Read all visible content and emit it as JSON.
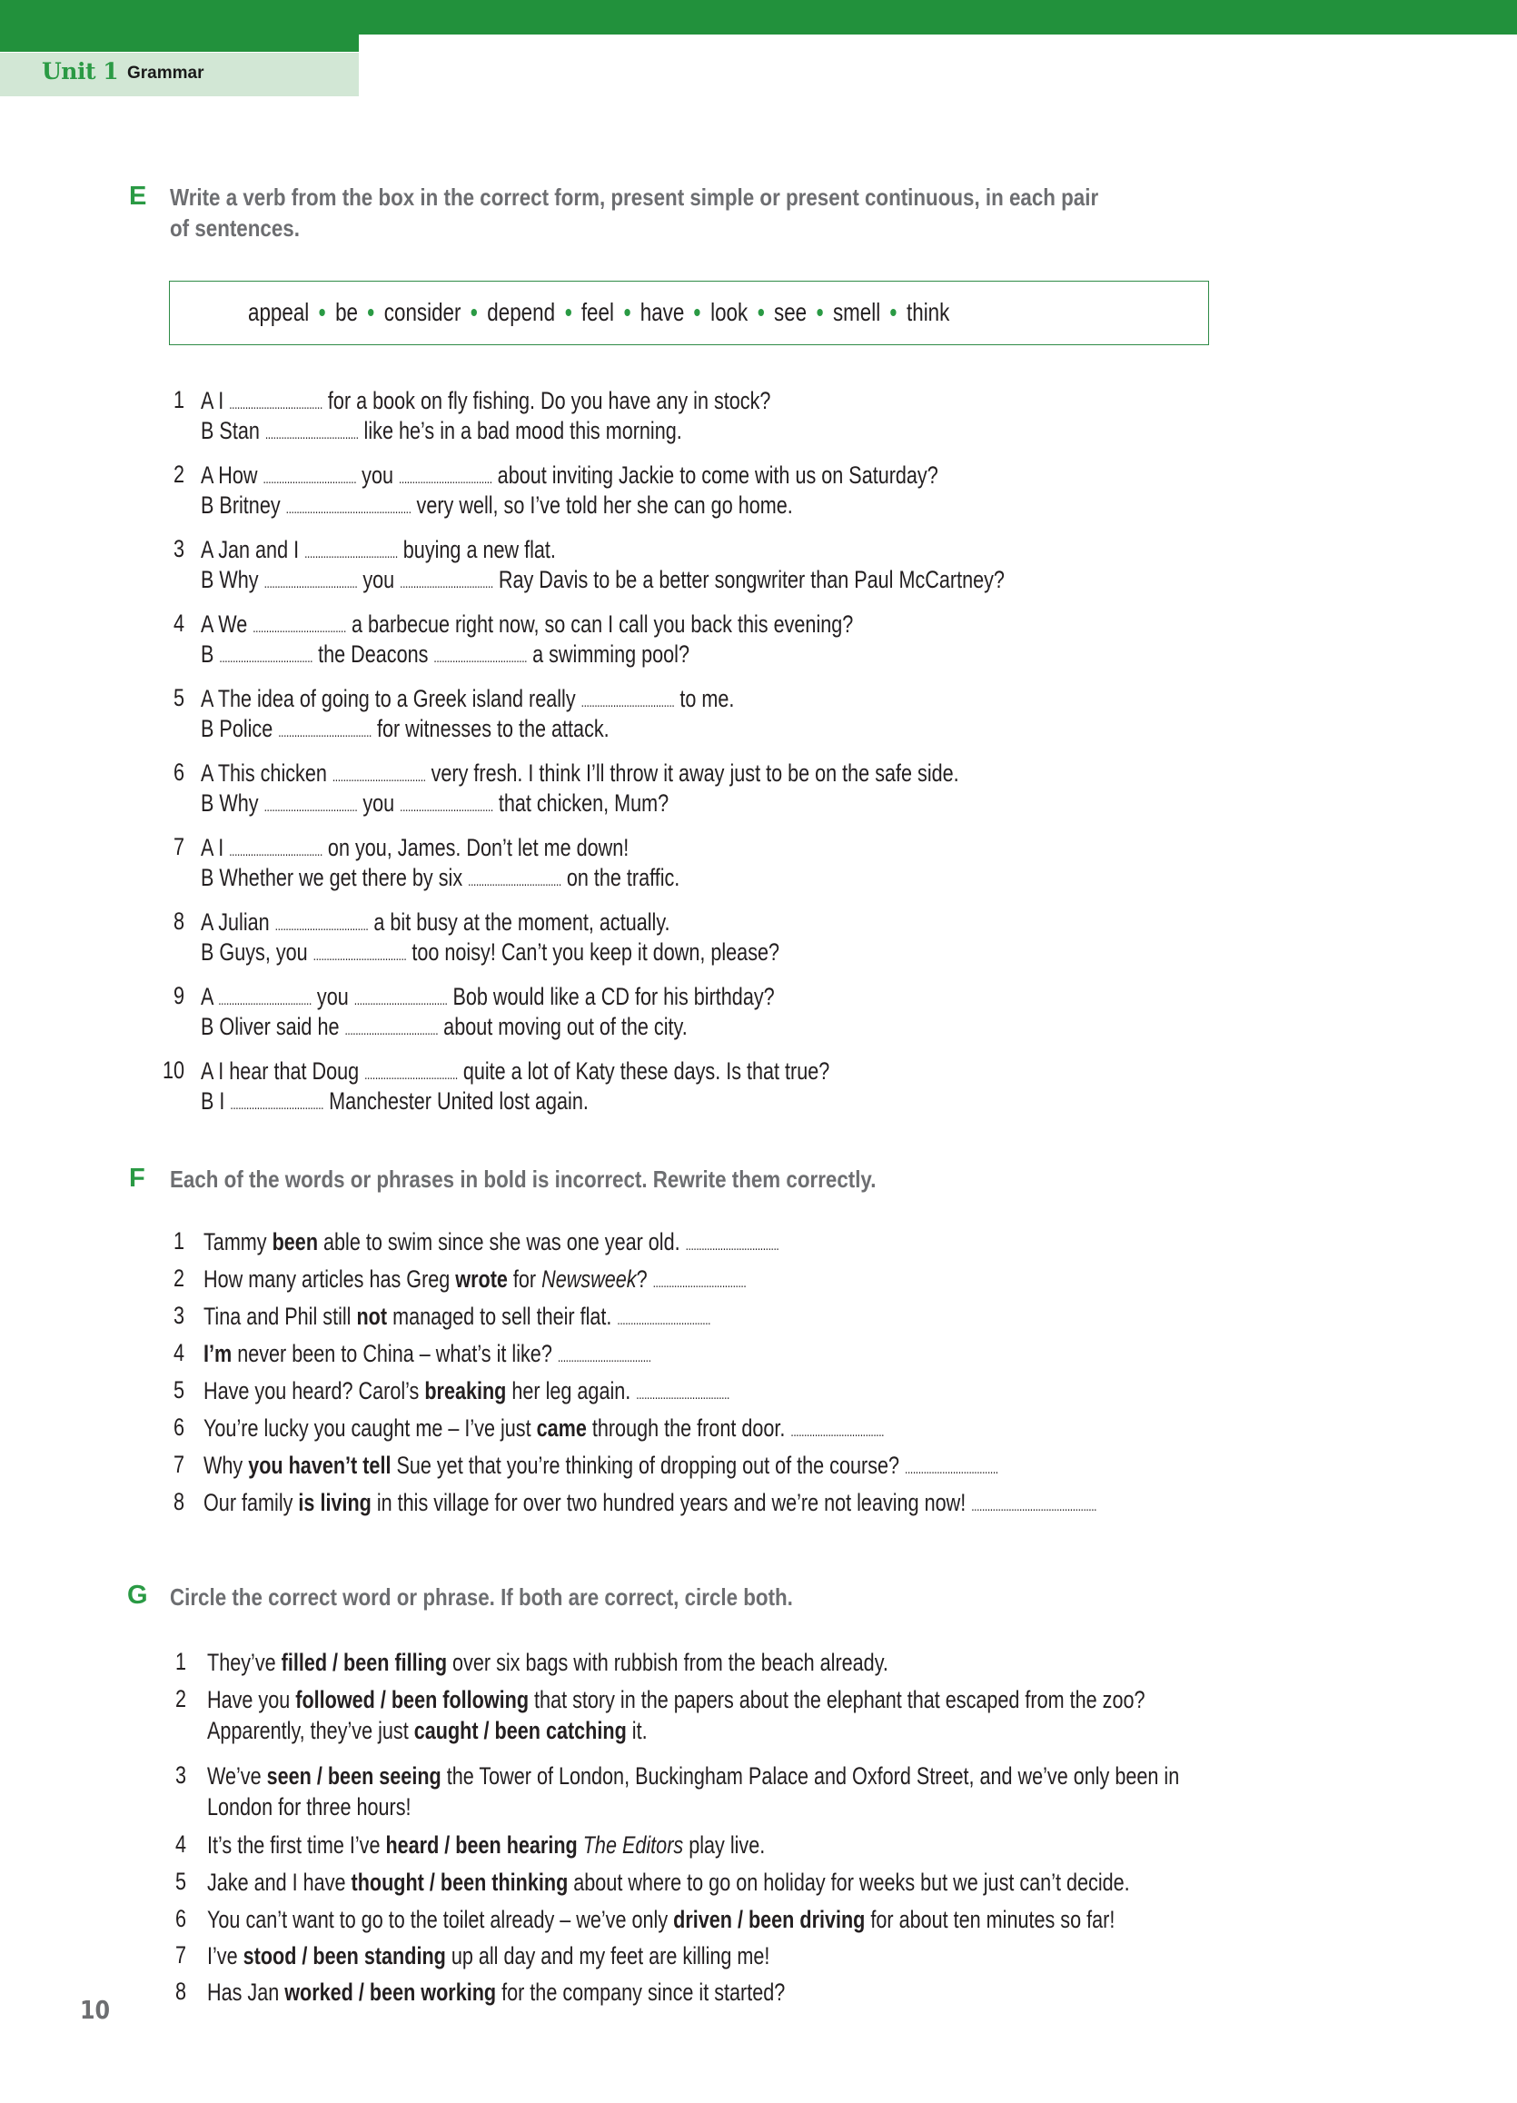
{
  "header": {
    "unit": "Unit 1",
    "section": "Grammar"
  },
  "colors": {
    "brand_green": "#22913c",
    "tab_light_green": "#d2e7d5",
    "instruction_gray": "#6d6e71"
  },
  "exercise_e": {
    "letter": "E",
    "instruction_line1": "Write a verb from the box in the correct form, present simple or present continuous, in each pair",
    "instruction_line2": "of sentences.",
    "word_box": [
      "appeal",
      "be",
      "consider",
      "depend",
      "feel",
      "have",
      "look",
      "see",
      "smell",
      "think"
    ],
    "blank": "...................................",
    "items": [
      {
        "num": "1",
        "a": [
          [
            "A I ",
            "blank"
          ],
          [
            " for a book on fly fishing. Do you have any in stock?"
          ]
        ],
        "b": [
          [
            "B Stan ",
            "blank"
          ],
          [
            " like he’s in a bad mood this morning."
          ]
        ]
      },
      {
        "num": "2",
        "a": [
          [
            "A How ",
            "blank"
          ],
          [
            " you ",
            "blank"
          ],
          [
            " about inviting Jackie to come with us on Saturday?"
          ]
        ],
        "b": [
          [
            "B Britney ",
            "blank_long"
          ],
          [
            " very well, so I’ve told her she can go home."
          ]
        ]
      },
      {
        "num": "3",
        "a": [
          [
            "A Jan and I ",
            "blank"
          ],
          [
            " buying a new flat."
          ]
        ],
        "b": [
          [
            "B Why ",
            "blank"
          ],
          [
            " you ",
            "blank"
          ],
          [
            " Ray Davis to be a better songwriter than Paul McCartney?"
          ]
        ]
      },
      {
        "num": "4",
        "a": [
          [
            "A We ",
            "blank"
          ],
          [
            " a barbecue right now, so can I call you back this evening?"
          ]
        ],
        "b": [
          [
            "B ",
            "blank"
          ],
          [
            " the Deacons ",
            "blank"
          ],
          [
            " a swimming pool?"
          ]
        ]
      },
      {
        "num": "5",
        "a": [
          [
            "A The idea of going to a Greek island really ",
            "blank"
          ],
          [
            " to me."
          ]
        ],
        "b": [
          [
            "B Police ",
            "blank"
          ],
          [
            " for witnesses to the attack."
          ]
        ]
      },
      {
        "num": "6",
        "a": [
          [
            "A This chicken ",
            "blank"
          ],
          [
            " very fresh. I think I’ll throw it away just to be on the safe side."
          ]
        ],
        "b": [
          [
            "B Why ",
            "blank"
          ],
          [
            " you ",
            "blank"
          ],
          [
            " that chicken, Mum?"
          ]
        ]
      },
      {
        "num": "7",
        "a": [
          [
            "A I ",
            "blank"
          ],
          [
            " on you, James. Don’t let me down!"
          ]
        ],
        "b": [
          [
            "B Whether we get there by six ",
            "blank"
          ],
          [
            " on the traffic."
          ]
        ]
      },
      {
        "num": "8",
        "a": [
          [
            "A Julian ",
            "blank"
          ],
          [
            " a bit busy at the moment, actually."
          ]
        ],
        "b": [
          [
            "B Guys, you ",
            "blank"
          ],
          [
            " too noisy! Can’t you keep it down, please?"
          ]
        ]
      },
      {
        "num": "9",
        "a": [
          [
            "A ",
            "blank"
          ],
          [
            " you ",
            "blank"
          ],
          [
            " Bob would like a CD for his birthday?"
          ]
        ],
        "b": [
          [
            "B Oliver said he ",
            "blank"
          ],
          [
            " about moving out of the city."
          ]
        ]
      },
      {
        "num": "10",
        "a": [
          [
            "A I hear that Doug ",
            "blank"
          ],
          [
            " quite a lot of Katy these days. Is that true?"
          ]
        ],
        "b": [
          [
            "B I ",
            "blank"
          ],
          [
            " Manchester United lost again."
          ]
        ]
      }
    ]
  },
  "exercise_f": {
    "letter": "F",
    "instruction": "Each of the words or phrases in bold is incorrect. Rewrite them correctly.",
    "items": [
      {
        "num": "1",
        "before": "Tammy ",
        "bold": "been",
        "after": " able to swim since she was one year old. ",
        "blank": "..................................."
      },
      {
        "num": "2",
        "before": "How many articles has Greg ",
        "bold": "wrote",
        "after": " for ",
        "italic": "Newsweek",
        "after2": "? ",
        "blank": "..................................."
      },
      {
        "num": "3",
        "before": "Tina and Phil still ",
        "bold": "not",
        "after": " managed to sell their flat.  ",
        "blank": "..................................."
      },
      {
        "num": "4",
        "before": "",
        "bold": "I’m",
        "after": " never been to China – what’s it like? ",
        "blank": "..................................."
      },
      {
        "num": "5",
        "before": "Have you heard? Carol’s ",
        "bold": "breaking",
        "after": " her leg again. ",
        "blank": "..................................."
      },
      {
        "num": "6",
        "before": "You’re lucky you caught me – I’ve just ",
        "bold": "came",
        "after": " through the front door. ",
        "blank": "..................................."
      },
      {
        "num": "7",
        "before": "Why ",
        "bold": "you haven’t tell",
        "after": " Sue yet that you’re thinking of dropping out of the course? ",
        "blank": "..................................."
      },
      {
        "num": "8",
        "before": "Our family ",
        "bold": "is living",
        "after": " in this village for over two hundred years and we’re not leaving now! ",
        "blank": "..............................................."
      }
    ]
  },
  "exercise_g": {
    "letter": "G",
    "instruction": "Circle the correct word or phrase. If both are correct, circle both.",
    "items": [
      {
        "num": "1",
        "lines": [
          [
            [
              "They’ve ",
              ""
            ],
            [
              "filled / been filling",
              "b"
            ],
            [
              " over six bags with rubbish from the beach already.",
              ""
            ]
          ]
        ]
      },
      {
        "num": "2",
        "lines": [
          [
            [
              "Have you ",
              ""
            ],
            [
              "followed / been following",
              "b"
            ],
            [
              " that story in the papers about the elephant that escaped from the zoo?",
              ""
            ]
          ],
          [
            [
              "Apparently, they’ve just ",
              ""
            ],
            [
              "caught / been catching",
              "b"
            ],
            [
              " it.",
              ""
            ]
          ]
        ]
      },
      {
        "num": "3",
        "lines": [
          [
            [
              "We’ve ",
              ""
            ],
            [
              "seen / been seeing",
              "b"
            ],
            [
              " the Tower of London, Buckingham Palace and Oxford Street, and we’ve only been in",
              ""
            ]
          ],
          [
            [
              "London for three hours!",
              ""
            ]
          ]
        ]
      },
      {
        "num": "4",
        "lines": [
          [
            [
              "It’s the first time I’ve ",
              ""
            ],
            [
              "heard / been hearing",
              "b"
            ],
            [
              " ",
              ""
            ],
            [
              "The Editors",
              "i"
            ],
            [
              " play live.",
              ""
            ]
          ]
        ]
      },
      {
        "num": "5",
        "lines": [
          [
            [
              "Jake and I have ",
              ""
            ],
            [
              "thought / been thinking",
              "b"
            ],
            [
              " about where to go on holiday for weeks but we just can’t decide.",
              ""
            ]
          ]
        ]
      },
      {
        "num": "6",
        "lines": [
          [
            [
              "You can’t want to go to the toilet already – we’ve only ",
              ""
            ],
            [
              "driven / been driving",
              "b"
            ],
            [
              " for about ten minutes so far!",
              ""
            ]
          ]
        ]
      },
      {
        "num": "7",
        "lines": [
          [
            [
              "I’ve ",
              ""
            ],
            [
              "stood / been standing",
              "b"
            ],
            [
              " up all day and my feet are killing me!",
              ""
            ]
          ]
        ]
      },
      {
        "num": "8",
        "lines": [
          [
            [
              "Has Jan ",
              ""
            ],
            [
              "worked / been working",
              "b"
            ],
            [
              " for the company since it started?",
              ""
            ]
          ]
        ]
      }
    ]
  },
  "page_number": "10"
}
